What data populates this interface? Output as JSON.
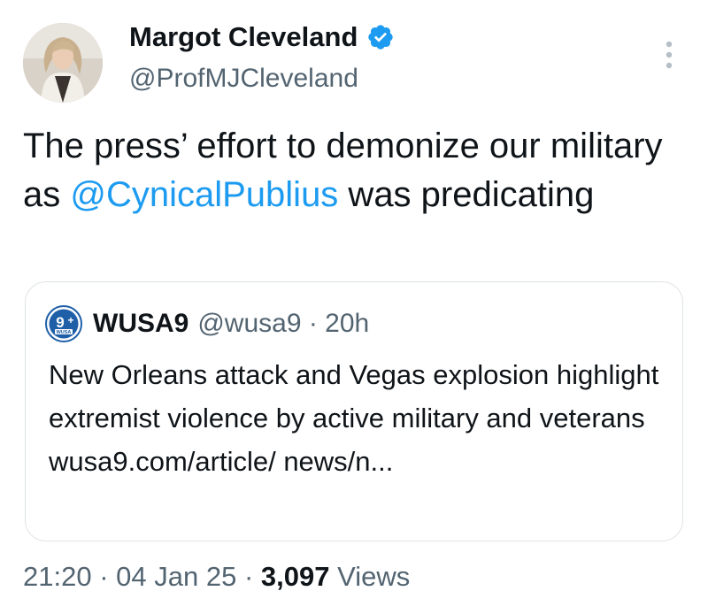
{
  "author": {
    "name": "Margot Cleveland",
    "handle": "@ProfMJCleveland",
    "avatar_icon": "profile-photo",
    "verified_icon": "verified-badge-icon",
    "verified_color": "#1d9bf0"
  },
  "tweet": {
    "text_before": "The press’ effort to demonize our military as ",
    "mention": "@CynicalPublius",
    "text_after": " was predicating"
  },
  "quote": {
    "logo_icon": "wusa9-logo",
    "name": "WUSA9",
    "meta": "@wusa9 · 20h",
    "text": "New Orleans attack and Vegas explosion highlight extremist violence by active military and veterans wusa9.com/article/ news/n..."
  },
  "footer": {
    "time": "21:20",
    "sep1": "·",
    "date": "04 Jan 25",
    "sep2": "·",
    "views_count": "3,097",
    "views_label": "Views"
  },
  "colors": {
    "text": "#0f1419",
    "secondary": "#536471",
    "link": "#1d9bf0",
    "border": "#dfe3e6"
  }
}
